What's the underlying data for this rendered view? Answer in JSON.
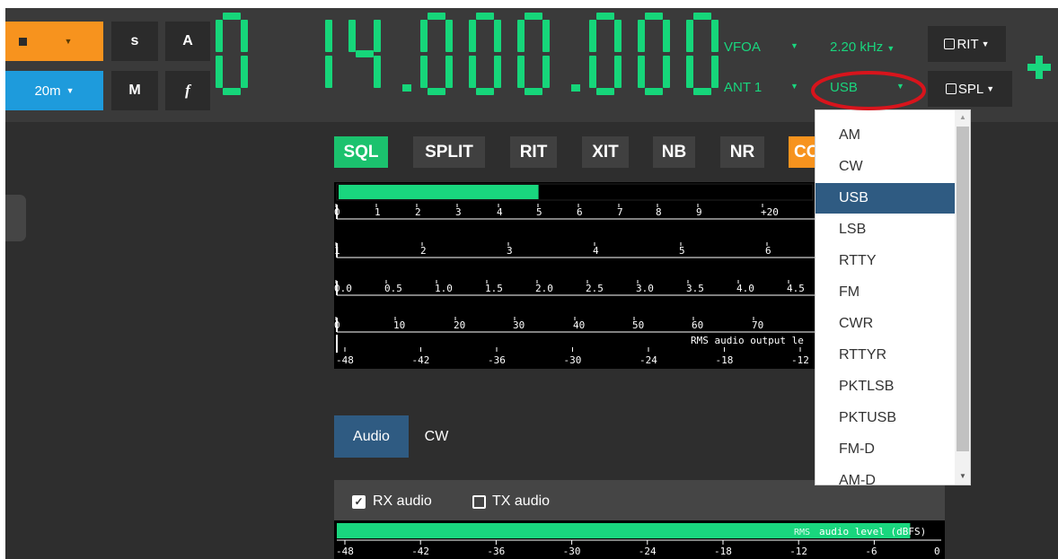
{
  "toolbar": {
    "band_label": "20m",
    "s_label": "s",
    "a_label": "A",
    "m_label": "M",
    "f_label": "f"
  },
  "frequency": "0 14.000.000",
  "vfo": {
    "vfo_label": "VFOA",
    "ant_label": "ANT 1",
    "bandwidth_label": "2.20 kHz",
    "mode_label": "USB",
    "rit_label": "RIT",
    "spl_label": "SPL"
  },
  "toggles": [
    "SQL",
    "SPLIT",
    "RIT",
    "XIT",
    "NB",
    "NR",
    "CO"
  ],
  "meters": {
    "s_meter_level": 0.42,
    "s_scale": [
      "0",
      "1",
      "2",
      "3",
      "4",
      "5",
      "6",
      "7",
      "8",
      "9",
      "+20"
    ],
    "swr_scale": [
      "1",
      "2",
      "3",
      "4",
      "5",
      "6"
    ],
    "alc_scale": [
      "0.0",
      "0.5",
      "1.0",
      "1.5",
      "2.0",
      "2.5",
      "3.0",
      "3.5",
      "4.0",
      "4.5"
    ],
    "power_scale": [
      "0",
      "10",
      "20",
      "30",
      "40",
      "50",
      "60",
      "70"
    ],
    "rms_label": "RMS audio output le",
    "db_scale": [
      "-48",
      "-42",
      "-36",
      "-30",
      "-24",
      "-18",
      "-12"
    ]
  },
  "tabs": [
    "Audio",
    "CW"
  ],
  "audio_panel": {
    "rx_label": "RX audio",
    "rx_checked": true,
    "tx_label": "TX audio",
    "tx_checked": false,
    "rms_tag": "RMS",
    "level_label": "audio level (dBFS)",
    "level_value": 0.95,
    "scale": [
      "-48",
      "-42",
      "-36",
      "-30",
      "-24",
      "-18",
      "-12",
      "-6",
      "0"
    ]
  },
  "mode_dropdown": {
    "selected": "USB",
    "options": [
      "AM",
      "CW",
      "USB",
      "LSB",
      "RTTY",
      "FM",
      "CWR",
      "RTTYR",
      "PKTLSB",
      "PKTUSB",
      "FM-D",
      "AM-D"
    ]
  },
  "colors": {
    "accent_green": "#19d67e",
    "lcd_green": "#16d67a",
    "orange": "#f7931e",
    "blue": "#1e9bdc",
    "selected_blue": "#2f5b82",
    "annotation_red": "#d8141c"
  }
}
